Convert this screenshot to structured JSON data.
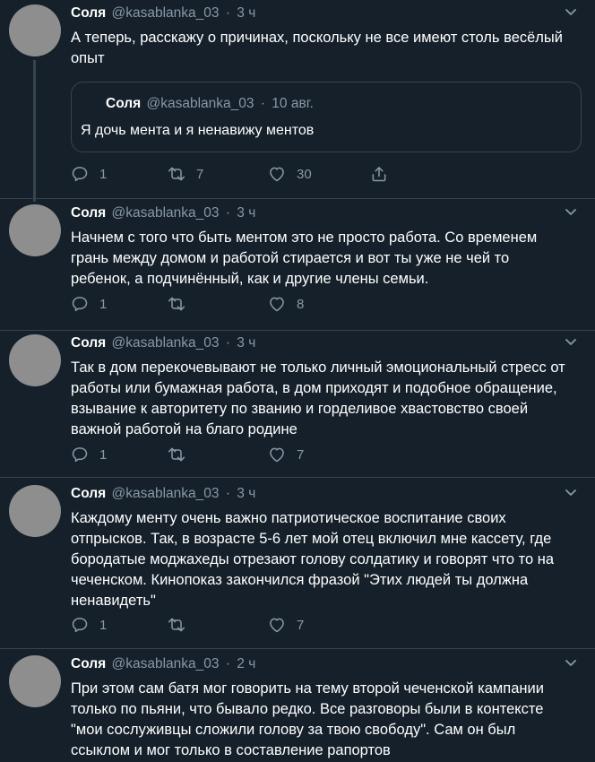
{
  "tweets": [
    {
      "name": "Соля",
      "handle": "@kasablanka_03",
      "sep": "·",
      "time": "3 ч",
      "lines": [
        "А теперь, расскажу о причинах, поскольку не все имеют столь весёлый",
        "опыт"
      ],
      "quote": {
        "name": "Соля",
        "handle": "@kasablanka_03",
        "sep": "·",
        "time": "10 авг.",
        "text": "Я дочь мента и я ненавижу ментов"
      },
      "replies": "1",
      "retweets": "7",
      "likes": "30"
    },
    {
      "name": "Соля",
      "handle": "@kasablanka_03",
      "sep": "·",
      "time": "3 ч",
      "lines": [
        "Начнем с того что быть ментом это не просто работа. Со временем",
        "грань между домом и работой стирается и вот ты уже не чей то",
        "ребенок, а подчинённый, как и другие члены семьи."
      ],
      "replies": "1",
      "retweets": "",
      "likes": "8"
    },
    {
      "name": "Соля",
      "handle": "@kasablanka_03",
      "sep": "·",
      "time": "3 ч",
      "lines": [
        "Так в дом перекочевывают не только личный эмоциональный стресс от",
        "работы или бумажная работа, в дом приходят и подобное обращение,",
        "взывание к авторитету по званию и горделивое хвастовство своей",
        "важной работой на благо родине"
      ],
      "replies": "1",
      "retweets": "",
      "likes": "7"
    },
    {
      "name": "Соля",
      "handle": "@kasablanka_03",
      "sep": "·",
      "time": "3 ч",
      "lines": [
        "Каждому менту очень важно патриотическое воспитание своих",
        "отпрысков. Так, в возрасте 5-6 лет мой отец включил мне кассету, где",
        "бородатые моджахеды отрезают голову солдатику и говорят что то на",
        "чеченском. Кинопоказ закончился фразой \"Этих людей ты должна",
        "ненавидеть\""
      ],
      "replies": "1",
      "retweets": "",
      "likes": "7"
    },
    {
      "name": "Соля",
      "handle": "@kasablanka_03",
      "sep": "·",
      "time": "2 ч",
      "lines": [
        "При этом сам батя мог говорить на тему второй чеченской кампании",
        "только по пьяни, что бывало редко. Все разговоры были в контексте",
        "\"мои сослуживцы сложили голову за твою свободу\". Сам он был",
        "ссыклом и мог только в составление рапортов"
      ]
    }
  ],
  "colors": {
    "background": "#15202b",
    "border": "#38444d",
    "secondary_text": "#8899a6",
    "avatar": "#8e8e8e"
  },
  "icons": [
    "caret-down-icon",
    "reply-icon",
    "retweet-icon",
    "like-icon",
    "share-icon"
  ]
}
